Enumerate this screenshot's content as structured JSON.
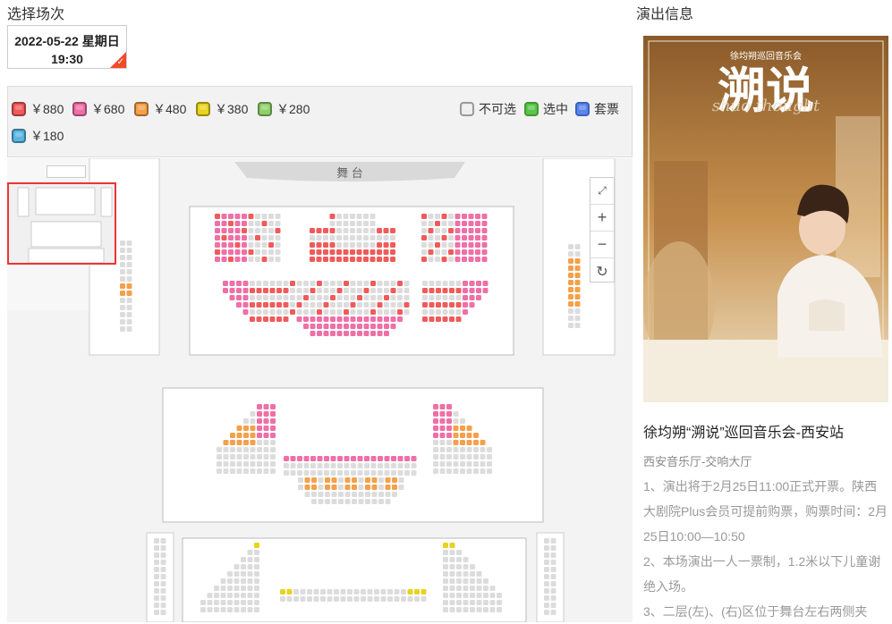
{
  "left_heading": "选择场次",
  "session": {
    "date": "2022-05-22 星期日",
    "time": "19:30"
  },
  "legend": {
    "prices": [
      {
        "label": "￥880",
        "color": "#f05a5a"
      },
      {
        "label": "￥680",
        "color": "#ef6fa6"
      },
      {
        "label": "￥480",
        "color": "#f5a04a"
      },
      {
        "label": "￥380",
        "color": "#e8d21e"
      },
      {
        "label": "￥280",
        "color": "#8fd06c"
      },
      {
        "label": "￥180",
        "color": "#58b6e0"
      }
    ],
    "status": [
      {
        "label": "不可选",
        "color": "#e6e6e6"
      },
      {
        "label": "选中",
        "color": "#5bc44a"
      },
      {
        "label": "套票",
        "color": "#5a86e8"
      }
    ]
  },
  "stage_label": "舞 台",
  "right_heading": "演出信息",
  "poster": {
    "top_text": "徐均朔巡回音乐会",
    "big_title": "溯说",
    "script_text": "shuo  thought"
  },
  "show_title": "徐均朔“溯说”巡回音乐会-西安站",
  "venue": "西安音乐厅-交响大厅",
  "description": [
    "1、演出将于2月25日11:00正式开票。陕西",
    "大剧院Plus会员可提前购票，购票时间：2月",
    "25日10:00—10:50",
    "2、本场演出一人一票制，1.2米以下儿童谢",
    "绝入场。",
    "3、二层(左)、(右)区位于舞台左右两侧夹"
  ],
  "icons": {
    "fullscreen": "fullscreen-icon",
    "zoom_in": "plus-icon",
    "zoom_out": "minus-icon",
    "reset": "refresh-icon"
  }
}
